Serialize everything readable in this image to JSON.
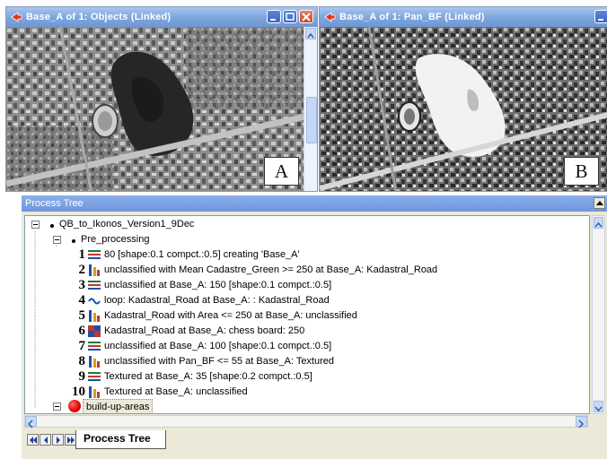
{
  "window_a": {
    "title": "Base_A of 1: Objects (Linked)",
    "label": "A"
  },
  "window_b": {
    "title": "Base_A of 1: Pan_BF (Linked)",
    "label": "B"
  },
  "process_tree": {
    "header": "Process Tree",
    "root": "QB_to_Ikonos_Version1_9Dec",
    "group": "Pre_processing",
    "steps": [
      {
        "num": "1",
        "icon": "segmentation-icon",
        "text": "80 [shape:0.1 compct.:0.5] creating 'Base_A'"
      },
      {
        "num": "2",
        "icon": "classification-icon",
        "text": "unclassified with Mean Cadastre_Green >= 250  at Base_A: Kadastral_Road"
      },
      {
        "num": "3",
        "icon": "segmentation-icon",
        "text": "unclassified at Base_A: 150 [shape:0.1 compct.:0.5]"
      },
      {
        "num": "4",
        "icon": "loop-icon",
        "text": "loop: Kadastral_Road at Base_A: : Kadastral_Road"
      },
      {
        "num": "5",
        "icon": "classification-icon",
        "text": "Kadastral_Road with Area <= 250  at Base_A: unclassified"
      },
      {
        "num": "6",
        "icon": "chessboard-icon",
        "text": "Kadastral_Road at Base_A: chess board: 250"
      },
      {
        "num": "7",
        "icon": "segmentation-icon",
        "text": "unclassified at Base_A: 100 [shape:0.1 compct.:0.5]"
      },
      {
        "num": "8",
        "icon": "classification-icon",
        "text": "unclassified with Pan_BF <= 55  at Base_A: Textured"
      },
      {
        "num": "9",
        "icon": "segmentation-icon",
        "text": "Textured at Base_A: 35 [shape:0.2 compct.:0.5]"
      },
      {
        "num": "10",
        "icon": "classification-icon",
        "text": "Textured at Base_A: unclassified"
      }
    ],
    "group2": "build-up-areas",
    "tab_label": "Process Tree"
  },
  "colors": {
    "titlebar": "#7da5dd",
    "panel": "#ece9d8",
    "selection_highlight": "#ece9d8",
    "red_node": "#e00000"
  }
}
